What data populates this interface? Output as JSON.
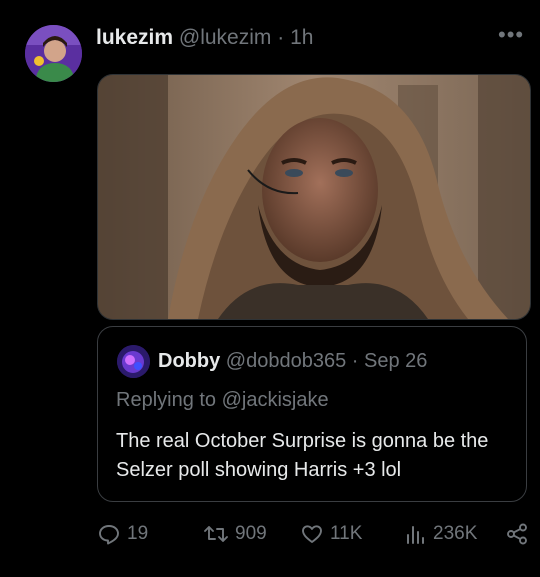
{
  "post": {
    "author_name": "lukezim",
    "author_handle": "@lukezim",
    "separator": "·",
    "time": "1h",
    "more_label": "•••"
  },
  "quote": {
    "author_name": "Dobby",
    "author_handle": "@dobdob365",
    "separator": "·",
    "date": "Sep 26",
    "replying_to": "Replying to @jackisjake",
    "text": "The real October Surprise is gonna be the Selzer poll showing Harris +3 lol"
  },
  "actions": {
    "replies": "19",
    "reposts": "909",
    "likes": "11K",
    "views": "236K"
  },
  "colors": {
    "background": "#000000",
    "text": "#e7e9ea",
    "muted": "#71767b",
    "border": "#2f3336"
  },
  "icons": [
    "more-icon",
    "reply-icon",
    "repost-icon",
    "like-icon",
    "views-icon",
    "share-icon"
  ]
}
